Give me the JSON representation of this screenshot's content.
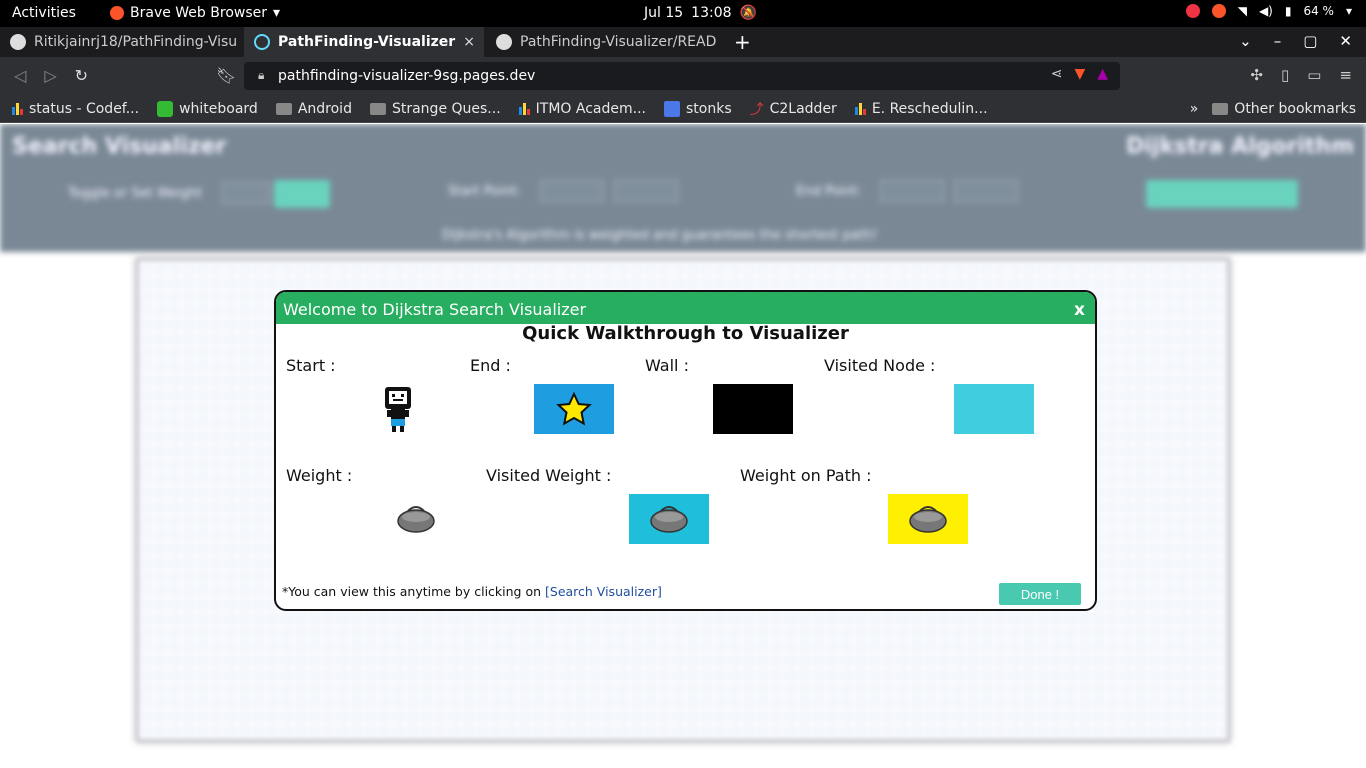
{
  "system_bar": {
    "activities": "Activities",
    "app_name": "Brave Web Browser",
    "date": "Jul 15",
    "time": "13:08",
    "battery": "64 %"
  },
  "tabs": [
    {
      "label": "Ritikjainrj18/PathFinding-Visu",
      "icon": "github-icon"
    },
    {
      "label": "PathFinding-Visualizer",
      "icon": "react-icon",
      "active": true,
      "close": "×"
    },
    {
      "label": "PathFinding-Visualizer/READ",
      "icon": "github-icon"
    }
  ],
  "new_tab": "+",
  "address_bar": {
    "url": "pathfinding-visualizer-9sg.pages.dev"
  },
  "bookmarks": [
    {
      "label": "status - Codef...",
      "icon": "bar-chart-icon"
    },
    {
      "label": "whiteboard",
      "icon": "whiteboard-icon"
    },
    {
      "label": "Android",
      "icon": "folder-icon"
    },
    {
      "label": "Strange Ques...",
      "icon": "folder-icon"
    },
    {
      "label": "ITMO Academ...",
      "icon": "bar-chart-icon"
    },
    {
      "label": "stonks",
      "icon": "doc-icon"
    },
    {
      "label": "C2Ladder",
      "icon": "chart-icon"
    },
    {
      "label": "E. Reschedulin...",
      "icon": "bar-chart-icon"
    }
  ],
  "bookmarks_overflow": "»",
  "other_bookmarks": "Other bookmarks",
  "app_header": {
    "title": "Search Visualizer",
    "algorithm": "Dijkstra Algorithm",
    "toggle_label": "Toggle or Set Weight",
    "start_label": "Start Point:",
    "end_label": "End Point:",
    "note": "Dijkstra's Algorithm is weighted and guarantees the shortest path!"
  },
  "modal": {
    "header": "Welcome to Dijkstra Search Visualizer",
    "close": "x",
    "title": "Quick Walkthrough to Visualizer",
    "labels": {
      "start": "Start :",
      "end": "End :",
      "wall": "Wall :",
      "visited_node": "Visited Node :",
      "weight": "Weight :",
      "visited_weight": "Visited Weight :",
      "weight_on_path": "Weight on Path :"
    },
    "colors": {
      "end": "#1e9ee0",
      "wall": "#000000",
      "visited_node": "#40cde0",
      "visited_weight": "#1fbfdc",
      "weight_on_path": "#ffef00",
      "header": "#27ae60"
    },
    "footer_text": "*You can view this anytime by clicking on ",
    "footer_link": "[Search Visualizer]",
    "done": "Done !"
  }
}
